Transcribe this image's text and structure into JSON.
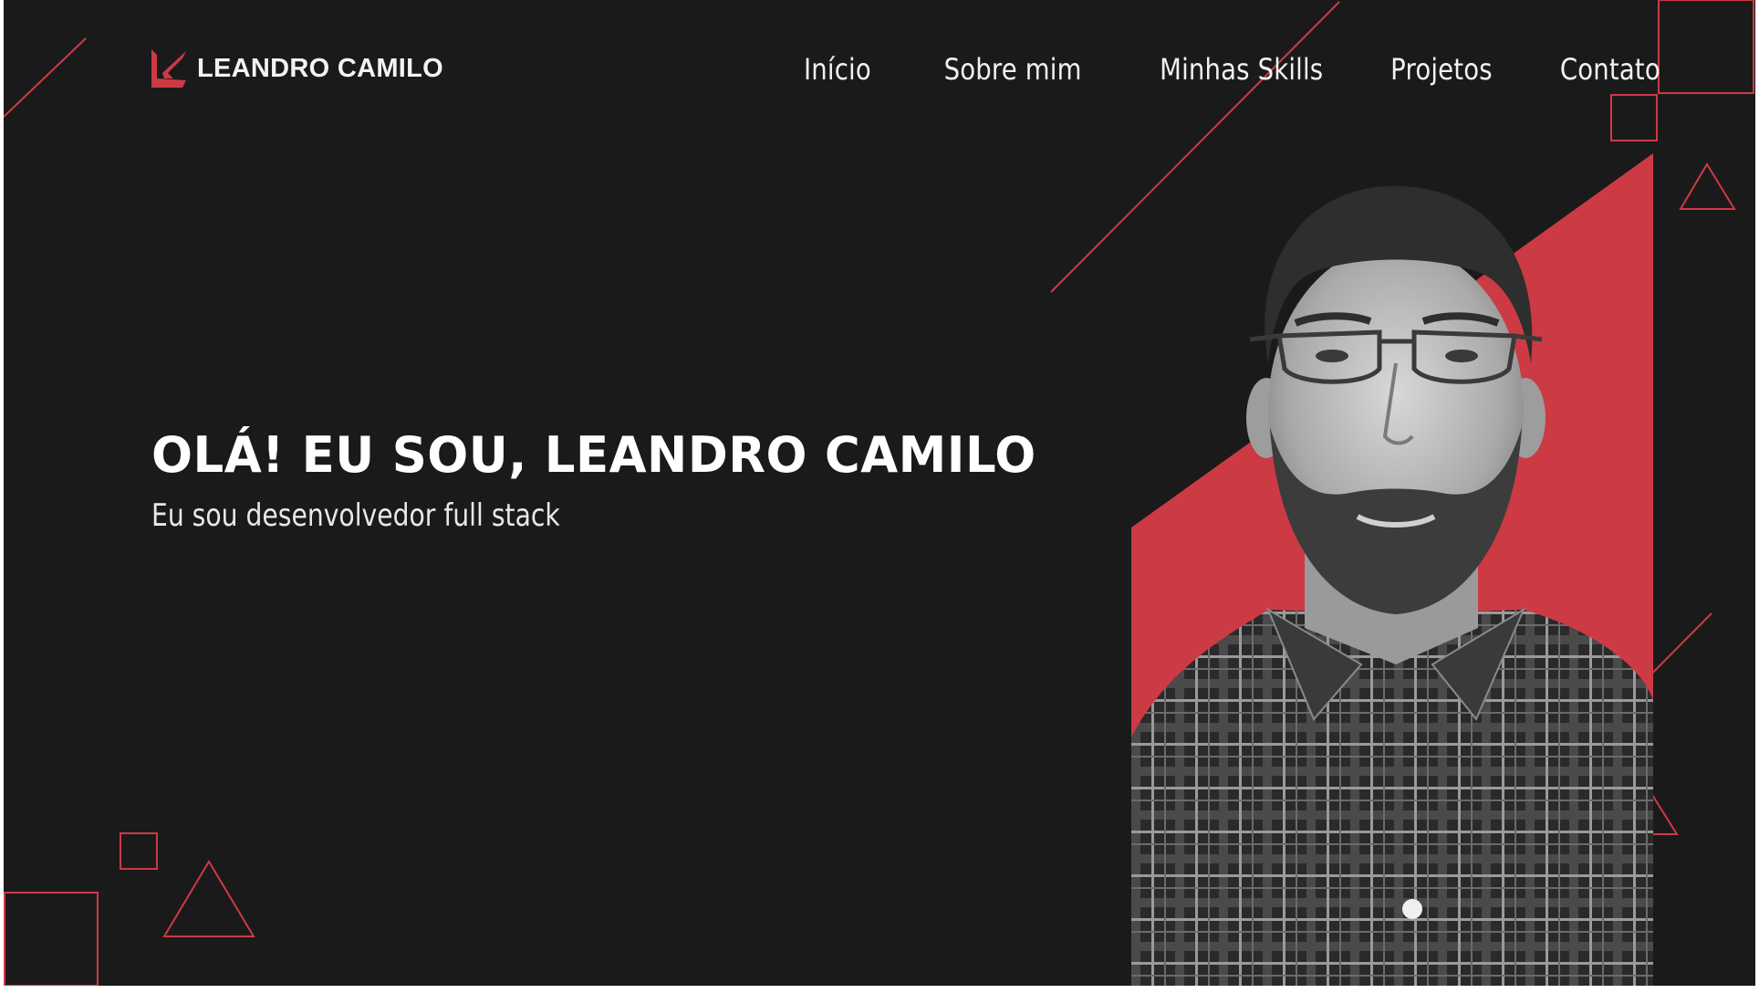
{
  "brand": {
    "name": "LEANDRO CAMILO",
    "logo_icon": "stylized-k-logo-icon",
    "accent_color": "#cc3a44"
  },
  "nav": {
    "items": [
      {
        "label": "Início"
      },
      {
        "label": "Sobre mim"
      },
      {
        "label": "Minhas Skills"
      },
      {
        "label": "Projetos"
      },
      {
        "label": "Contato"
      }
    ]
  },
  "hero": {
    "title": "OLÁ! EU SOU, LEANDRO CAMILO",
    "subtitle": "Eu sou desenvolvedor full stack"
  },
  "colors": {
    "background": "#1b1a1b",
    "text": "#ffffff",
    "accent": "#cc3a44"
  }
}
